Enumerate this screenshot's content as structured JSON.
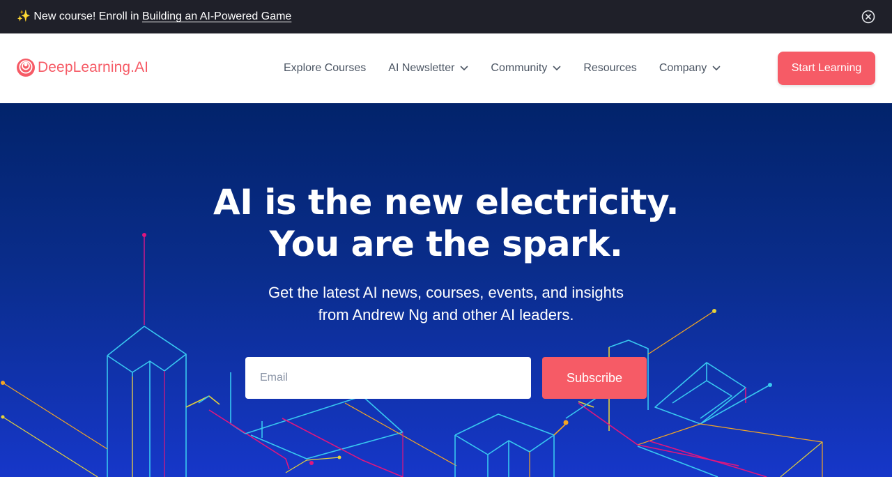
{
  "announcement": {
    "emoji": "✨",
    "prefix": " New course! Enroll in ",
    "link_text": "Building an AI-Powered Game",
    "close_icon": "close-circle-icon"
  },
  "nav": {
    "logo_text": "DeepLearning.AI",
    "logo_icon": "deeplearning-logo-icon",
    "items": [
      {
        "label": "Explore Courses",
        "has_dropdown": false
      },
      {
        "label": "AI Newsletter",
        "has_dropdown": true
      },
      {
        "label": "Community",
        "has_dropdown": true
      },
      {
        "label": "Resources",
        "has_dropdown": false
      },
      {
        "label": "Company",
        "has_dropdown": true
      }
    ],
    "cta_label": "Start Learning"
  },
  "hero": {
    "headline_line1": "AI is the new electricity.",
    "headline_line2": "You are the spark.",
    "subhead_line1": "Get the latest AI news, courses, events, and insights",
    "subhead_line2": "from Andrew Ng and other AI leaders.",
    "email_placeholder": "Email",
    "email_value": "",
    "subscribe_label": "Subscribe"
  },
  "colors": {
    "brand": "#f65b66",
    "announcement_bg": "#1f2029",
    "hero_top": "#02236b",
    "hero_bottom": "#1637c9",
    "nav_text": "#4b5563"
  }
}
